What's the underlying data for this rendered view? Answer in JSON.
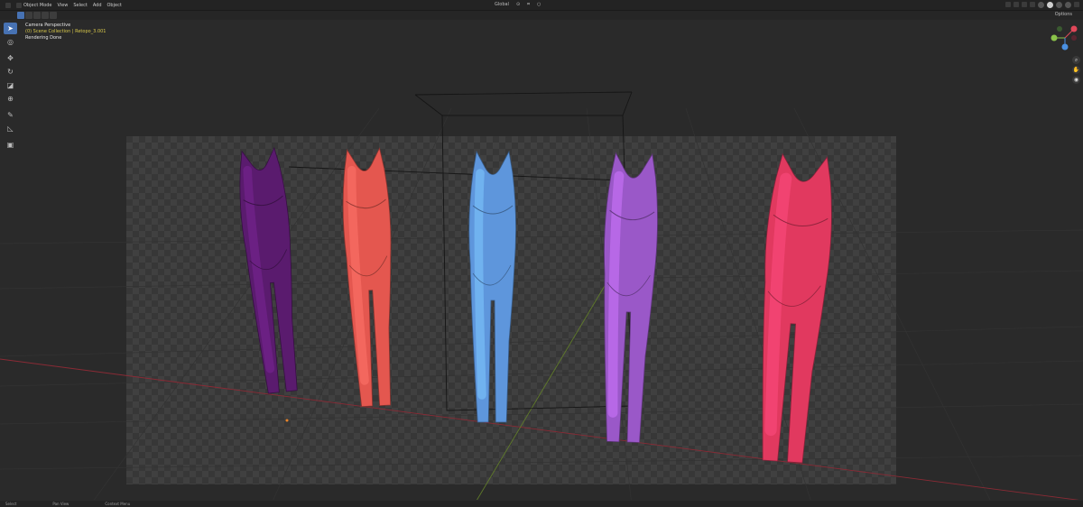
{
  "header": {
    "mode": "Object Mode",
    "menus": [
      "View",
      "Select",
      "Add",
      "Object"
    ],
    "transform_orientation": "Global"
  },
  "subheader": {
    "options_label": "Options"
  },
  "overlay": {
    "view_name": "Camera Perspective",
    "collection": "(0) Scene Collection | Retopo_3.001",
    "status": "Rendering Done"
  },
  "gizmo": {
    "axes": [
      "X",
      "Y",
      "Z"
    ],
    "axis_colors": {
      "x": "#e2485a",
      "y": "#8bc34a",
      "z": "#4a90e2"
    }
  },
  "statusbar": {
    "items": [
      "Select",
      "Pan View",
      "Context Menu"
    ]
  },
  "scene": {
    "objects": [
      {
        "name": "suit-purple-dark",
        "color": "#5a1b6e"
      },
      {
        "name": "suit-coral",
        "color": "#e4574f"
      },
      {
        "name": "suit-blue",
        "color": "#5e96dc"
      },
      {
        "name": "suit-violet",
        "color": "#9a58c8"
      },
      {
        "name": "suit-pink",
        "color": "#e1395f"
      }
    ]
  }
}
